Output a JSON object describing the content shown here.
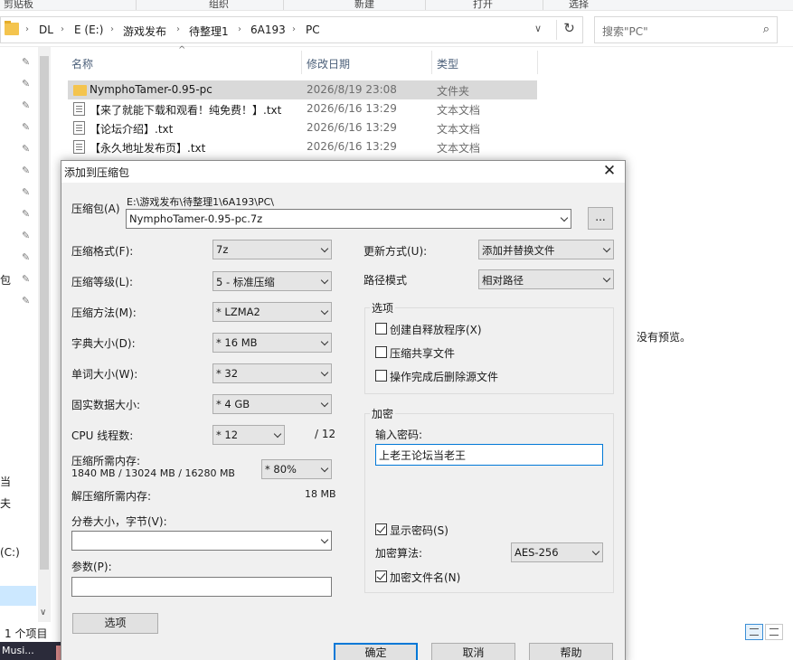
{
  "ribbon": {
    "labels": [
      "剪贴板",
      "组织",
      "新建",
      "打开",
      "选择"
    ]
  },
  "address": {
    "crumbs": [
      "DL",
      "E (E:)",
      "游戏发布",
      "待整理1",
      "6A193",
      "PC"
    ],
    "search_placeholder": "搜索\"PC\""
  },
  "nav": {
    "fragments": [
      "包",
      "当",
      "夫",
      "(C:)"
    ]
  },
  "file_list": {
    "columns": {
      "name": "名称",
      "date": "修改日期",
      "type": "类型"
    },
    "rows": [
      {
        "name": "NymphoTamer-0.95-pc",
        "date": "2026/8/19 23:08",
        "type": "文件夹",
        "icon": "folder-icon"
      },
      {
        "name": "【来了就能下载和观看！纯免费！】.txt",
        "date": "2026/6/16 13:29",
        "type": "文本文档",
        "icon": "text-file-icon"
      },
      {
        "name": "【论坛介绍】.txt",
        "date": "2026/6/16 13:29",
        "type": "文本文档",
        "icon": "text-file-icon"
      },
      {
        "name": "【永久地址发布页】.txt",
        "date": "2026/6/16 13:29",
        "type": "文本文档",
        "icon": "text-file-icon"
      }
    ]
  },
  "preview": {
    "text": "没有预览。"
  },
  "status": {
    "count": "1 个项目"
  },
  "taskbar": {
    "label": "Musi..."
  },
  "dialog": {
    "title": "添加到压缩包",
    "archive_label": "压缩包(A)",
    "archive_path": "E:\\游戏发布\\待整理1\\6A193\\PC\\",
    "archive_name": "NymphoTamer-0.95-pc.7z",
    "browse_label": "...",
    "format_label": "压缩格式(F):",
    "format_value": "7z",
    "level_label": "压缩等级(L):",
    "level_value": "5 - 标准压缩",
    "method_label": "压缩方法(M):",
    "method_value": "* LZMA2",
    "dict_label": "字典大小(D):",
    "dict_value": "* 16 MB",
    "word_label": "单词大小(W):",
    "word_value": "* 32",
    "solid_label": "固实数据大小:",
    "solid_value": "* 4 GB",
    "threads_label": "CPU 线程数:",
    "threads_value": "* 12",
    "threads_max": "/ 12",
    "mem_comp_label": "压缩所需内存:",
    "mem_comp_detail": "1840 MB / 13024 MB / 16280 MB",
    "mem_comp_value": "* 80%",
    "mem_decomp_label": "解压缩所需内存:",
    "mem_decomp_value": "18 MB",
    "split_label": "分卷大小，字节(V):",
    "split_value": "",
    "params_label": "参数(P):",
    "params_value": "",
    "options_button": "选项",
    "update_label": "更新方式(U):",
    "update_value": "添加并替换文件",
    "pathmode_label": "路径模式",
    "pathmode_value": "相对路径",
    "options_group": "选项",
    "opt_sfx": "创建自释放程序(X)",
    "opt_shared": "压缩共享文件",
    "opt_delete": "操作完成后删除源文件",
    "encrypt_group": "加密",
    "password_label": "输入密码:",
    "password_value": "上老王论坛当老王",
    "show_password": "显示密码(S)",
    "enc_method_label": "加密算法:",
    "enc_method_value": "AES-256",
    "enc_names": "加密文件名(N)",
    "ok": "确定",
    "cancel": "取消",
    "help": "帮助"
  }
}
